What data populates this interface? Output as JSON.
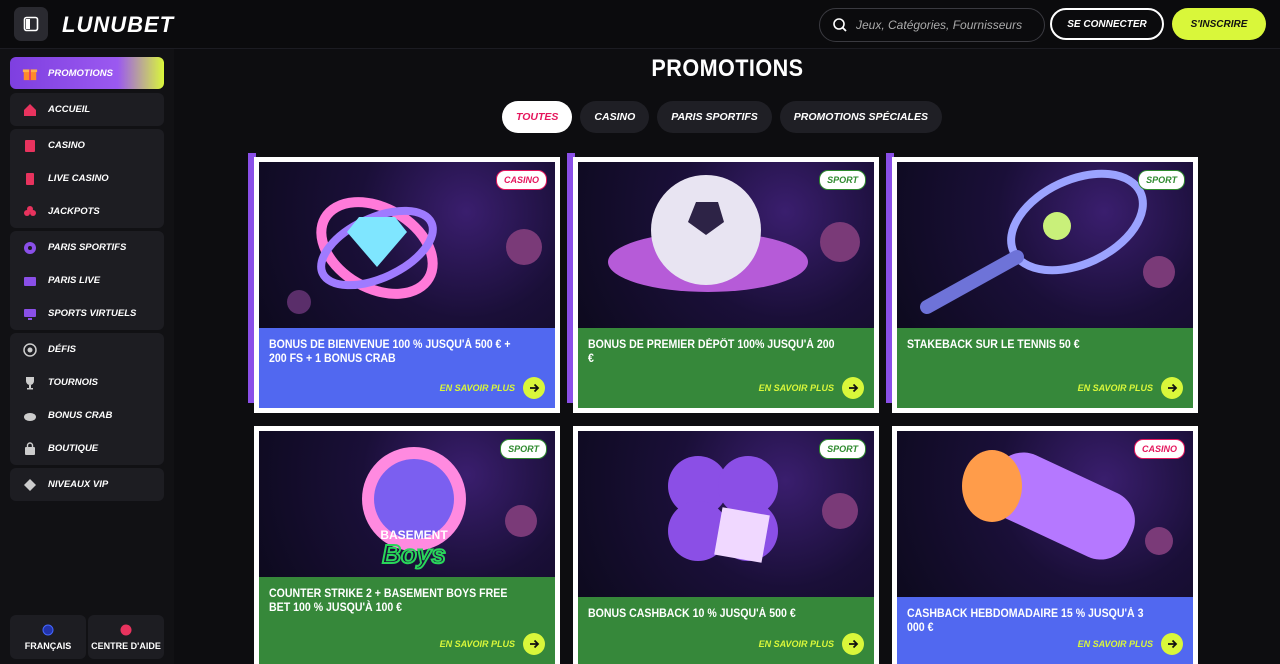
{
  "header": {
    "logo": "LUNUBET",
    "search_placeholder": "Jeux, Catégories, Fournisseurs",
    "login_label": "SE CONNECTER",
    "register_label": "S'INSCRIRE"
  },
  "sidebar": {
    "promo": "PROMOTIONS",
    "groups": [
      [
        "ACCUEIL"
      ],
      [
        "CASINO",
        "LIVE CASINO",
        "JACKPOTS"
      ],
      [
        "PARIS SPORTIFS",
        "PARIS LIVE",
        "SPORTS VIRTUELS"
      ],
      [
        "DÉFIS",
        "TOURNOIS",
        "BONUS CRAB",
        "BOUTIQUE"
      ],
      [
        "NIVEAUX VIP"
      ]
    ],
    "language": "FRANÇAIS",
    "help": "CENTRE D'AIDE"
  },
  "main": {
    "title": "PROMOTIONS",
    "tabs": [
      "TOUTES",
      "CASINO",
      "PARIS SPORTIFS",
      "PROMOTIONS SPÉCIALES"
    ],
    "more_label": "EN SAVOIR PLUS",
    "cards": [
      {
        "badge": "CASINO",
        "title": "BONUS DE BIENVENUE 100 % JUSQU'À 500 € + 200 FS + 1 BONUS CRAB"
      },
      {
        "badge": "SPORT",
        "title": "BONUS DE PREMIER DÉPÔT 100% JUSQU'À 200 €"
      },
      {
        "badge": "SPORT",
        "title": "STAKEBACK SUR LE TENNIS 50 €"
      },
      {
        "badge": "SPORT",
        "title": "COUNTER STRIKE 2 + BASEMENT BOYS FREE BET 100 % JUSQU'À 100 €",
        "art_text_1": "BASEMENT",
        "art_text_2": "Boys"
      },
      {
        "badge": "SPORT",
        "title": "BONUS CASHBACK 10 % JUSQU'À 500 €"
      },
      {
        "badge": "CASINO",
        "title": "CASHBACK HEBDOMADAIRE 15 % JUSQU'À 3 000 €"
      }
    ]
  },
  "colors": {
    "accent_lime": "#d9f73a",
    "accent_purple": "#8a4fe8",
    "casino_pink": "#e5175d",
    "card_blue": "#5168f0",
    "card_green": "#36883a"
  }
}
